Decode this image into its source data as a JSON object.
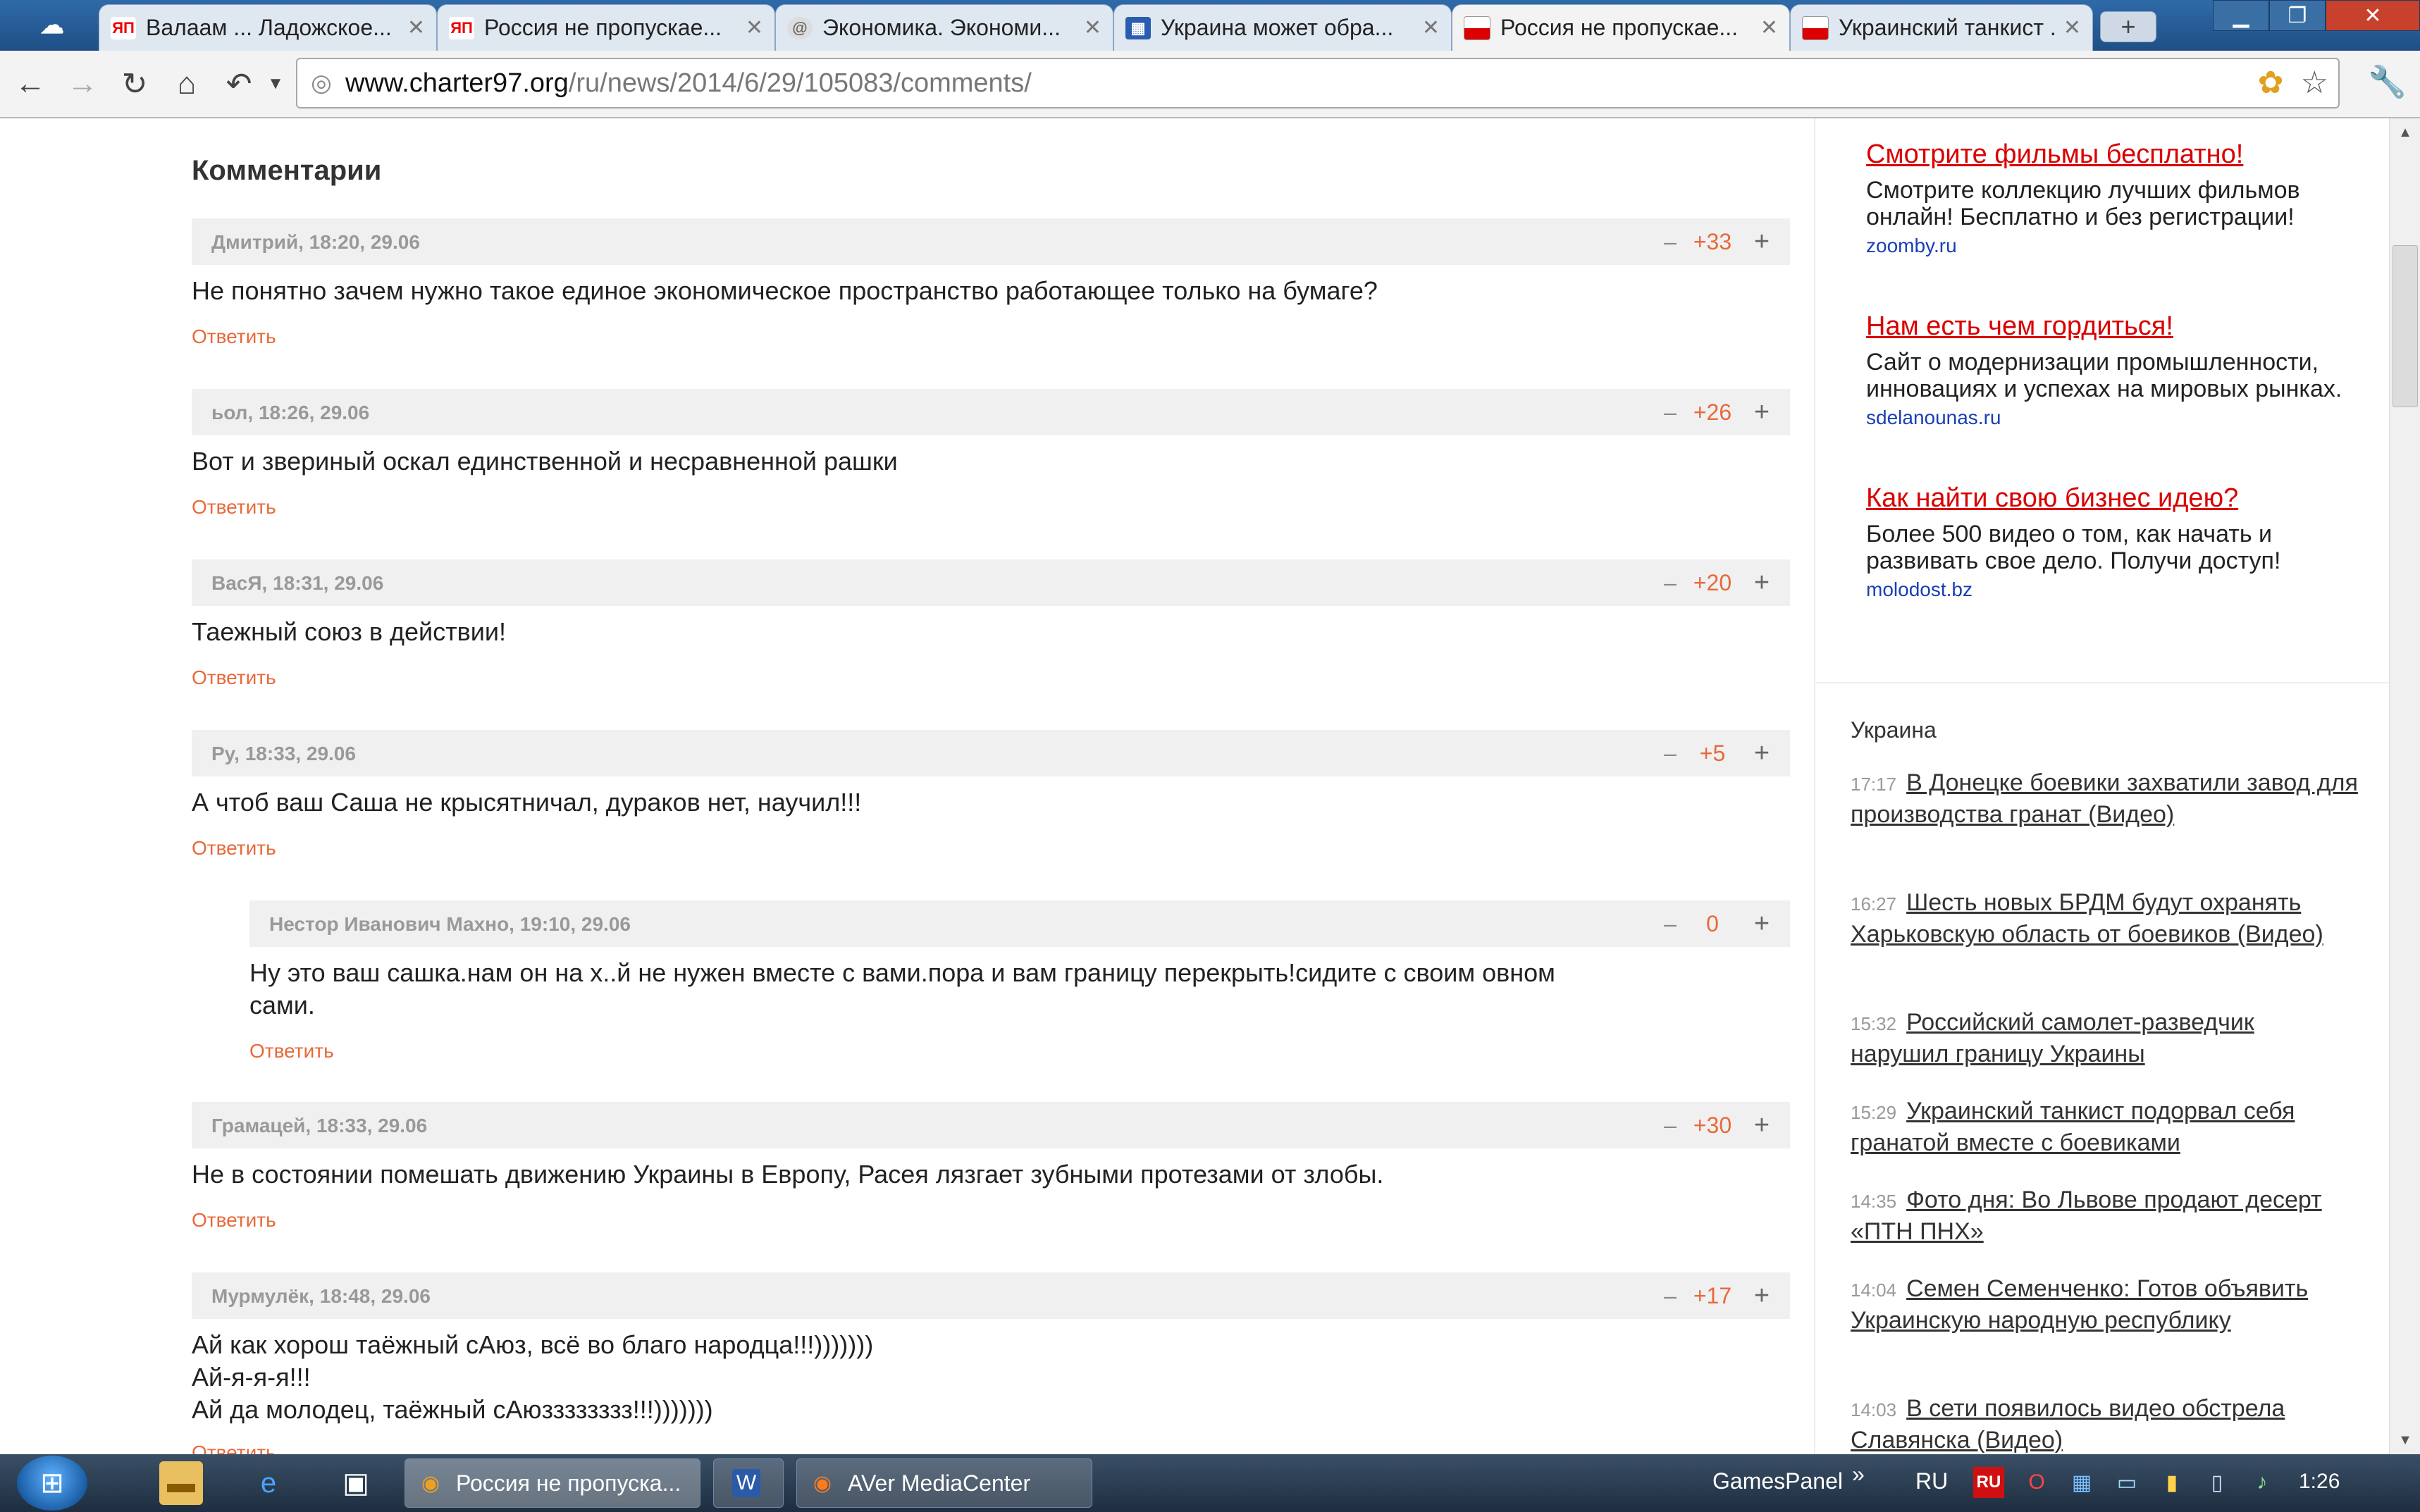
{
  "browser": {
    "tabs": [
      {
        "title": "Валаам ... Ладожское...",
        "icon": "ya-icon",
        "active": false
      },
      {
        "title": "Россия не пропускае...",
        "icon": "ya-icon",
        "active": false
      },
      {
        "title": "Экономика. Экономи...",
        "icon": "at-icon",
        "active": false
      },
      {
        "title": "Украина может обра...",
        "icon": "site-icon",
        "active": false
      },
      {
        "title": "Россия не пропускае...",
        "icon": "flag-icon",
        "active": true
      },
      {
        "title": "Украинский танкист ...",
        "icon": "flag-icon",
        "active": false
      }
    ],
    "url_host": "www.charter97.org",
    "url_path": "/ru/news/2014/6/29/105083/comments/"
  },
  "page": {
    "heading": "Комментарии",
    "reply_label": "Ответить",
    "comments": [
      {
        "author": "Дмитрий, 18:20, 29.06",
        "score": "+33",
        "text": "Не понятно зачем нужно такое единое экономическое пространство работающее только на бумаге?"
      },
      {
        "author": "ьол, 18:26, 29.06",
        "score": "+26",
        "text": "Вот и звериный оскал единственной и несравненной рашки"
      },
      {
        "author": "ВасЯ, 18:31, 29.06",
        "score": "+20",
        "text": "Таежный союз в действии!"
      },
      {
        "author": "Ру, 18:33, 29.06",
        "score": "+5",
        "text": "А чтоб ваш Саша не крысятничал, дураков нет, научил!!!"
      },
      {
        "author": "Нестор Иванович Махно, 19:10, 29.06",
        "score": "0",
        "text": "Ну это ваш сашка.нам он на х..й не нужен вместе с вами.пора и вам границу перекрыть!сидите с своим овном\nсами."
      },
      {
        "author": "Грамацей, 18:33, 29.06",
        "score": "+30",
        "text": "Не в состоянии помешать движению Украины в Европу, Расея лязгает зубными протезами от злобы."
      },
      {
        "author": "Мурмулёк, 18:48, 29.06",
        "score": "+17",
        "text": "Ай как хорош таёжный сАюз, всё во благо народца!!!)))))))\nАй-я-я-я!!!\nАй да молодец, таёжный сАюзззззззз!!!)))))))"
      }
    ],
    "vote_minus": "–",
    "vote_plus": "+",
    "ads": [
      {
        "title": "Смотрите фильмы бесплатно!",
        "desc": "Смотрите коллекцию лучших фильмов онлайн! Бесплатно и без регистрации!",
        "domain": "zoomby.ru"
      },
      {
        "title": "Нам есть чем гордиться!",
        "desc": "Сайт о модернизации промышленности, инновациях и успехах на мировых рынках.",
        "domain": "sdelanounas.ru"
      },
      {
        "title": "Как найти свою бизнес идею?",
        "desc": "Более 500 видео о том, как начать и развивать свое дело. Получи доступ!",
        "domain": "molodost.bz"
      }
    ],
    "news_heading": "Украина",
    "news": [
      {
        "time": "17:17",
        "title": "В Донецке боевики захватили завод для производства гранат (Видео)"
      },
      {
        "time": "16:27",
        "title": "Шесть новых БРДМ будут охранять Харьковскую область от боевиков (Видео)"
      },
      {
        "time": "15:32",
        "title": "Российский самолет-разведчик нарушил границу Украины"
      },
      {
        "time": "15:29",
        "title": "Украинский танкист подорвал себя гранатой вместе с боевиками"
      },
      {
        "time": "14:35",
        "title": "Фото дня: Во Львове продают десерт «ПТН ПНХ»"
      },
      {
        "time": "14:04",
        "title": "Семен Семенченко: Готов объявить Украинскую народную республику"
      },
      {
        "time": "14:03",
        "title": "В сети появилось видео обстрела Славянска (Видео)"
      }
    ]
  },
  "taskbar": {
    "tasks": [
      {
        "label": "Россия не пропуска...",
        "active": true
      },
      {
        "label": "",
        "active": false
      },
      {
        "label": "AVer MediaCenter",
        "active": false
      }
    ],
    "gamespanel": "GamesPanel",
    "tray_expand": "»",
    "language": "RU",
    "tray_lang_badge": "RU",
    "clock": "1:26"
  },
  "colors": {
    "accent_orange": "#e8693a",
    "ad_red": "#d90000",
    "ad_domain_blue": "#1a3fb5"
  }
}
